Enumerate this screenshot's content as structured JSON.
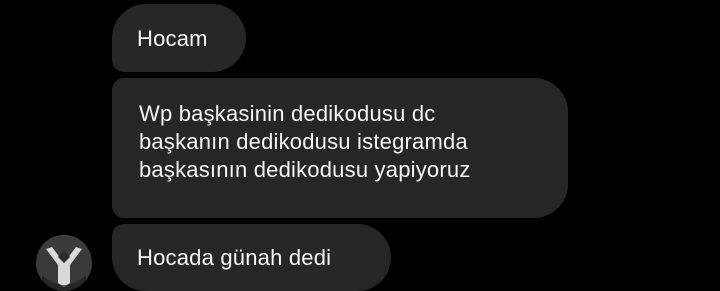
{
  "messages": [
    {
      "lines": [
        "Hocam"
      ]
    },
    {
      "lines": [
        "Wp başkasinin dedikodusu dc",
        "başkanın dedikodusu istegramda",
        "başkasının dedikodusu yapiyoruz"
      ]
    },
    {
      "lines": [
        "Hocada günah dedi"
      ]
    }
  ],
  "avatar": {
    "icon": "profile-avatar"
  },
  "colors": {
    "background": "#000000",
    "bubble": "#262626",
    "text": "#f5f5f5"
  }
}
